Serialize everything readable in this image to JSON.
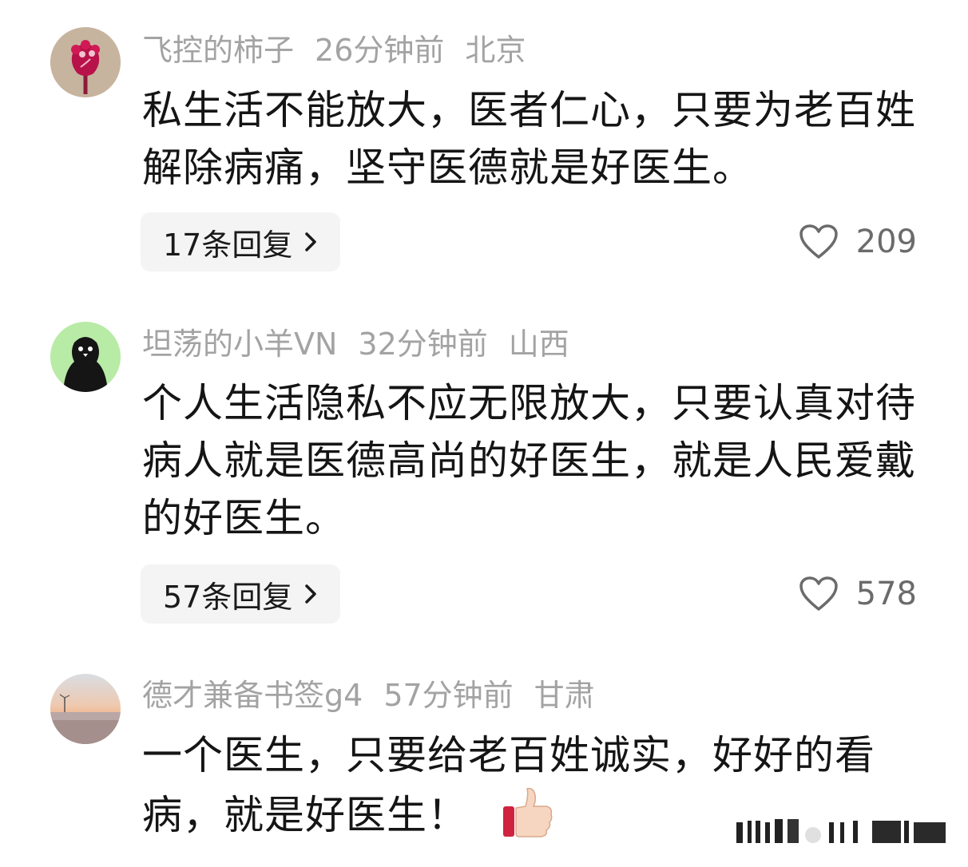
{
  "comments": [
    {
      "user": "飞控的柿子",
      "time": "26分钟前",
      "location": "北京",
      "text": "私生活不能放大，医者仁心，只要为老百姓解除病痛，坚守医德就是好医生。",
      "replies": "17条回复",
      "likes": "209",
      "avatar_icon": "red-flower-avatar"
    },
    {
      "user": "坦荡的小羊VN",
      "time": "32分钟前",
      "location": "山西",
      "text": "个人生活隐私不应无限放大，只要认真对待病人就是医德高尚的好医生，就是人民爱戴的好医生。",
      "replies": "57条回复",
      "likes": "578",
      "avatar_icon": "black-bird-avatar"
    },
    {
      "user": "德才兼备书签g4",
      "time": "57分钟前",
      "location": "甘肃",
      "text": "一个医生，只要给老百姓诚实，好好的看病，就是好医生！",
      "emoji": "thumbs-up-icon",
      "avatar_icon": "sunset-beach-avatar"
    }
  ],
  "colors": {
    "meta": "#a3a3a3",
    "text": "#151515",
    "reply_bg": "#f4f4f4",
    "like": "#6b6b6b"
  }
}
